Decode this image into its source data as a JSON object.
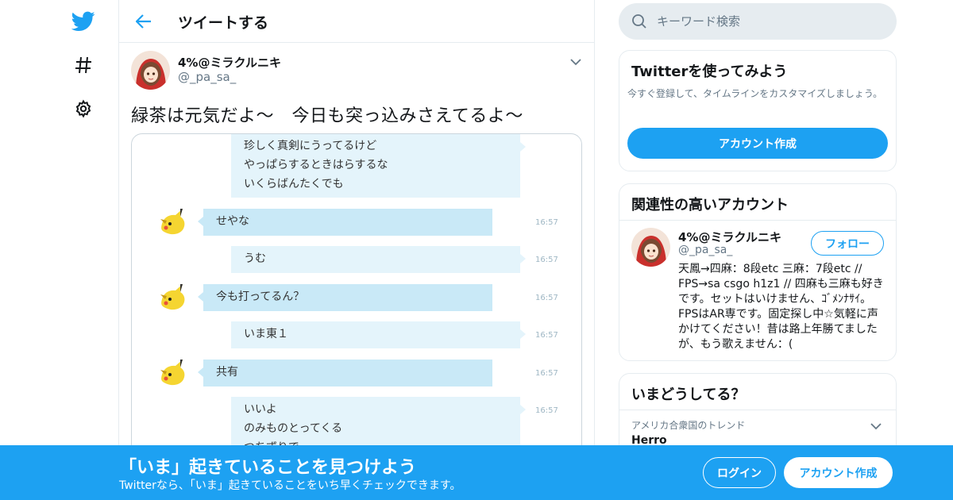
{
  "colors": {
    "accent": "#1da1f2",
    "border": "#e6ecf0",
    "muted": "#657786"
  },
  "nav": {
    "icons": [
      "twitter-bird-icon",
      "hashtag-icon",
      "gear-icon"
    ]
  },
  "header": {
    "title": "ツイートする"
  },
  "tweet": {
    "author_name": "4%@ミラクルニキ",
    "author_handle": "@_pa_sa_",
    "text": "緑茶は元気だよ～　今日も突っ込みさえてるよ～",
    "chat": [
      {
        "side": "me",
        "lines": [
          "珍しく真剣にうってるけど",
          "やっぱらするときはらするな",
          "いくらばんたくでも"
        ],
        "time": ""
      },
      {
        "side": "them",
        "lines": [
          "せやな"
        ],
        "time": "16:57"
      },
      {
        "side": "me",
        "lines": [
          "うむ"
        ],
        "time": "16:57"
      },
      {
        "side": "them",
        "lines": [
          "今も打ってるん？"
        ],
        "time": "16:57"
      },
      {
        "side": "me",
        "lines": [
          "いま東１"
        ],
        "time": "16:57"
      },
      {
        "side": "them",
        "lines": [
          "共有"
        ],
        "time": "16:57"
      },
      {
        "side": "me",
        "lines": [
          "いいよ",
          "のみものとってくる",
          "つちずりで"
        ],
        "time": "16:57"
      }
    ]
  },
  "search": {
    "placeholder": "キーワード検索"
  },
  "signup_card": {
    "title": "Twitterを使ってみよう",
    "description": "今すぐ登録して、タイムラインをカスタマイズしましょう。",
    "button": "アカウント作成"
  },
  "related": {
    "title": "関連性の高いアカウント",
    "name": "4%@ミラクルニキ",
    "handle": "@_pa_sa_",
    "follow_label": "フォロー",
    "bio": "天鳳→四麻：8段etc 三麻：7段etc // FPS→sa csgo h1z1 // 四麻も三麻も好きです。セットはいけません、ｺﾞﾒﾝﾅｻｲ。FPSはAR専です。固定探し中☆気軽に声かけてください！昔は路上年勝てましたが、もう歌えません：("
  },
  "trends": {
    "title": "いまどうしてる？",
    "context": "アメリカ合衆国のトレンド",
    "first_trend": "Herro"
  },
  "banner": {
    "title": "「いま」起きていることを見つけよう",
    "subtitle": "Twitterなら、「いま」起きていることをいち早くチェックできます。",
    "login": "ログイン",
    "signup": "アカウント作成"
  }
}
